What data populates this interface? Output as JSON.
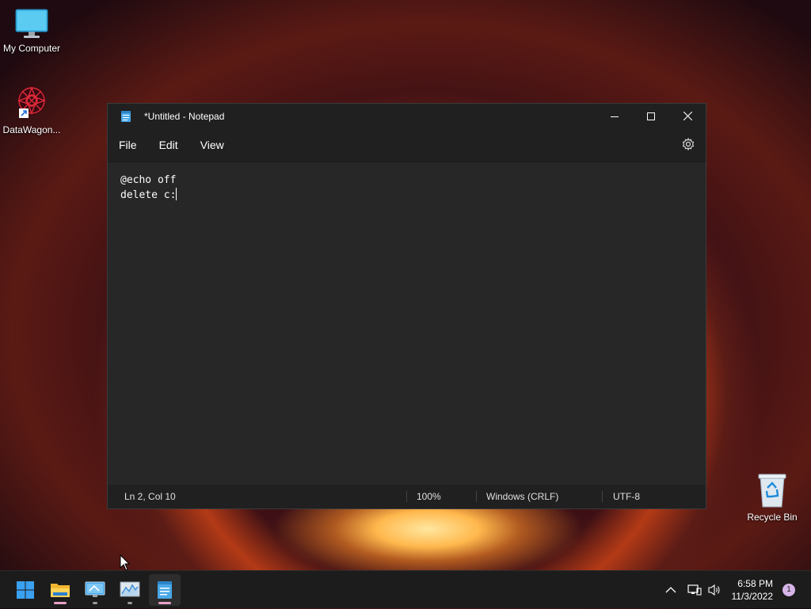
{
  "desktop": {
    "icons": [
      {
        "label": "My Computer"
      },
      {
        "label": "DataWagon..."
      },
      {
        "label": "Recycle Bin"
      }
    ]
  },
  "window": {
    "title": "*Untitled - Notepad",
    "menu": [
      "File",
      "Edit",
      "View"
    ],
    "content_lines": [
      "@echo off",
      "delete c:"
    ],
    "status": {
      "position": "Ln 2, Col 10",
      "zoom": "100%",
      "line_ending": "Windows (CRLF)",
      "encoding": "UTF-8"
    }
  },
  "taskbar": {
    "time": "6:58 PM",
    "date": "11/3/2022",
    "notification_count": "1"
  },
  "colors": {
    "accent": "#e8a0c8",
    "window_bg": "#272727",
    "titlebar_bg": "#202020",
    "taskbar_bg": "#1c1c1c"
  }
}
